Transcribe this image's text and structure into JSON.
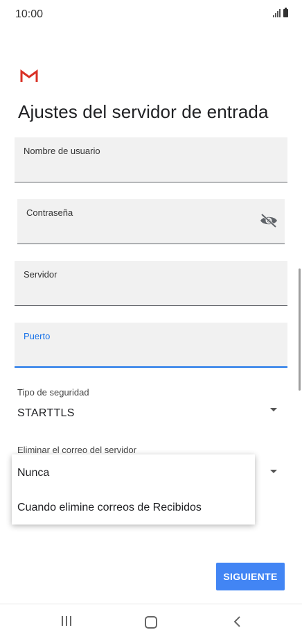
{
  "status_bar": {
    "time": "10:00"
  },
  "header": {
    "title": "Ajustes del servidor de entrada"
  },
  "form": {
    "username": {
      "label": "Nombre de usuario",
      "value": ""
    },
    "password": {
      "label": "Contraseña",
      "value": ""
    },
    "server": {
      "label": "Servidor",
      "value": ""
    },
    "port": {
      "label": "Puerto",
      "value": ""
    },
    "security_type": {
      "label": "Tipo de seguridad",
      "value": "STARTTLS"
    },
    "delete_from_server": {
      "label": "Eliminar el correo del servidor",
      "options": [
        "Nunca",
        "Cuando elimine correos de Recibidos"
      ]
    }
  },
  "actions": {
    "next_label": "SIGUIENTE"
  },
  "colors": {
    "accent": "#4285f4",
    "active_field": "#1a73e8",
    "gmail_red": "#d93025"
  }
}
